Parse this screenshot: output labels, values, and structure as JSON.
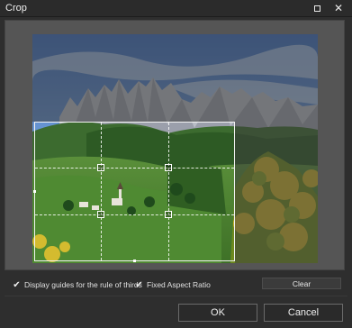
{
  "window": {
    "title": "Crop",
    "maximize_icon": "maximize-icon",
    "close_icon": "close-icon",
    "close_glyph": "✕"
  },
  "options": {
    "rule_of_thirds": {
      "label": "Display guides for the rule of thirds",
      "checked": true,
      "glyph": "✔"
    },
    "fixed_aspect": {
      "label": "Fixed Aspect Ratio",
      "checked": true,
      "glyph": "✔"
    }
  },
  "buttons": {
    "clear": "Clear",
    "ok": "OK",
    "cancel": "Cancel"
  },
  "colors": {
    "accent_border": "#6a6a6a",
    "background": "#2e2e2e"
  }
}
